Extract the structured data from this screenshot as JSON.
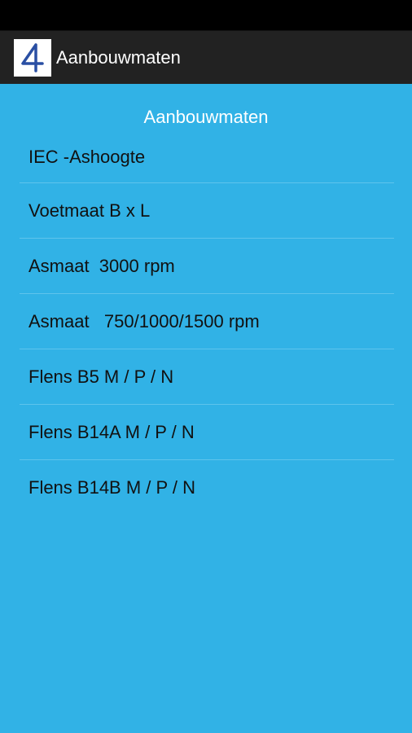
{
  "app": {
    "title": "Aanbouwmaten",
    "icon_name": "number-4-icon",
    "accent_color": "#31b2e6",
    "actionbar_color": "#222222"
  },
  "main": {
    "section_title": "Aanbouwmaten",
    "items": [
      {
        "label": "IEC -Ashoogte"
      },
      {
        "label": "Voetmaat B x L"
      },
      {
        "label": "Asmaat  3000 rpm"
      },
      {
        "label": "Asmaat   750/1000/1500 rpm"
      },
      {
        "label": "Flens B5 M / P / N"
      },
      {
        "label": "Flens B14A M / P / N"
      },
      {
        "label": "Flens B14B M / P / N"
      }
    ]
  }
}
